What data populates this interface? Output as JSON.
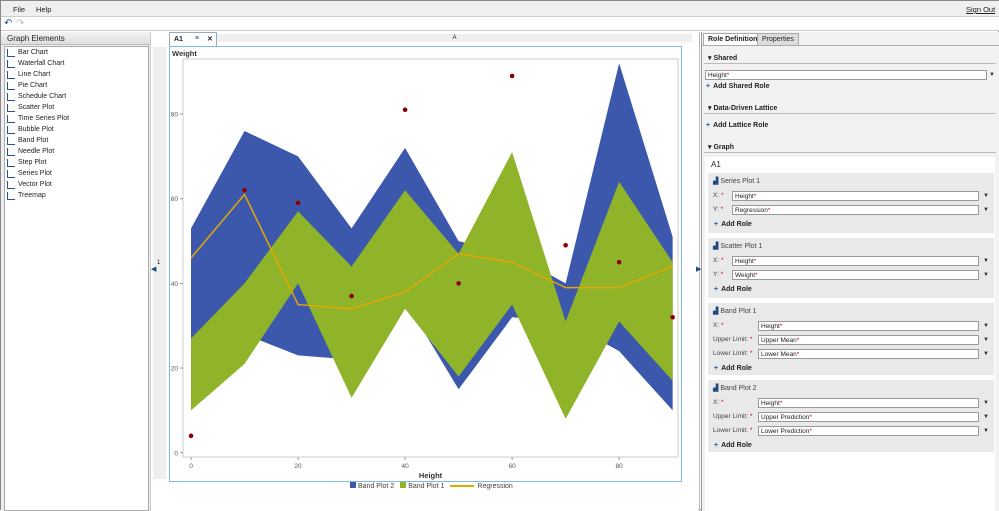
{
  "menu": {
    "file": "File",
    "help": "Help",
    "sign_out": "Sign Out"
  },
  "left_panel": {
    "title": "Graph Elements",
    "items": [
      "Bar Chart",
      "Waterfall Chart",
      "Line Chart",
      "Pie Chart",
      "Schedule Chart",
      "Scatter Plot",
      "Time Series Plot",
      "Bubble Plot",
      "Band Plot",
      "Needle Plot",
      "Step Plot",
      "Series Plot",
      "Vector Plot",
      "Treemap"
    ]
  },
  "center": {
    "tab": "A1",
    "column_header": "A",
    "row_header": "1"
  },
  "right_panel": {
    "tabs": [
      "Role Definitions",
      "Properties"
    ],
    "shared": "Shared",
    "shared_value": "Height",
    "add_shared_role": "Add Shared Role",
    "lattice": "Data-Driven Lattice",
    "add_lattice_role": "Add Lattice Role",
    "graph": "Graph",
    "cell": "A1",
    "add_role": "Add Role",
    "plots": [
      {
        "title": "Series Plot 1",
        "roles": [
          {
            "label": "X:",
            "value": "Height"
          },
          {
            "label": "Y:",
            "value": "Regression"
          }
        ]
      },
      {
        "title": "Scatter Plot 1",
        "roles": [
          {
            "label": "X:",
            "value": "Height"
          },
          {
            "label": "Y:",
            "value": "Weight"
          }
        ]
      },
      {
        "title": "Band Plot 1",
        "roles": [
          {
            "label": "X:",
            "value": "Height"
          },
          {
            "label": "Upper Limit:",
            "value": "Upper Mean"
          },
          {
            "label": "Lower Limit:",
            "value": "Lower Mean"
          }
        ]
      },
      {
        "title": "Band Plot 2",
        "roles": [
          {
            "label": "X:",
            "value": "Height"
          },
          {
            "label": "Upper Limit:",
            "value": "Upper Prediction"
          },
          {
            "label": "Lower Limit:",
            "value": "Lower Prediction"
          }
        ]
      }
    ]
  },
  "chart_data": {
    "type": "band+line+scatter",
    "xlabel": "Height",
    "ylabel": "Weight",
    "xlim": [
      -1.5,
      91
    ],
    "ylim": [
      -1,
      93
    ],
    "xticks": [
      0,
      20,
      40,
      60,
      80
    ],
    "yticks": [
      0,
      20,
      40,
      60,
      80
    ],
    "x": [
      0,
      10,
      20,
      30,
      40,
      50,
      60,
      70,
      80,
      90
    ],
    "series": [
      {
        "name": "Band Plot 2",
        "type": "band",
        "color": "#3c58ad",
        "upper": [
          53,
          76,
          70,
          53,
          72,
          50,
          47,
          40,
          92,
          51
        ],
        "lower": [
          10,
          28,
          23,
          22,
          36,
          15,
          32,
          31,
          24,
          10
        ]
      },
      {
        "name": "Band Plot 1",
        "type": "band",
        "color": "#8fb329",
        "upper": [
          27,
          40,
          57,
          44,
          62,
          47,
          71,
          31,
          64,
          45
        ],
        "lower": [
          10,
          21,
          40,
          13,
          34,
          18,
          35,
          8,
          31,
          17
        ]
      },
      {
        "name": "Regression",
        "type": "line",
        "color": "#e0a800",
        "values": [
          46,
          61,
          35,
          34,
          38,
          47,
          45,
          39,
          39,
          44
        ]
      },
      {
        "name": "Weight",
        "type": "scatter",
        "color": "#8b0000",
        "values": [
          4,
          62,
          59,
          37,
          81,
          40,
          89,
          49,
          45,
          32
        ]
      }
    ],
    "legend": [
      "Band Plot 2",
      "Band Plot 1",
      "Regression"
    ],
    "legend_position": "bottom"
  }
}
